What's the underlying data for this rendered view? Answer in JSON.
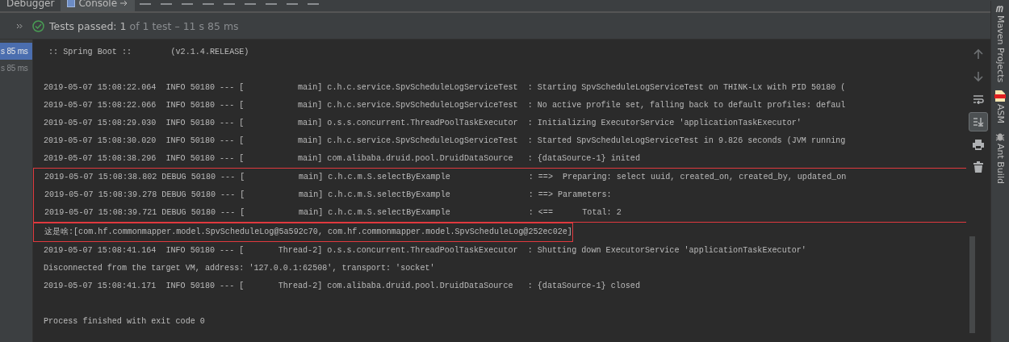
{
  "tool_tabs": [
    {
      "label": "Debugger",
      "selected": false
    },
    {
      "label": "Console",
      "selected": true
    }
  ],
  "test_status": {
    "passed": true,
    "label": "Tests passed:",
    "count": "1",
    "of_text": "of 1 test",
    "duration": "– 11 s 85 ms"
  },
  "sidebar": {
    "items": [
      {
        "label": "s 85 ms",
        "selected": true
      },
      {
        "label": "s 85 ms",
        "selected": false
      }
    ]
  },
  "console": {
    "blocks": [
      {
        "kind": "line",
        "text": " :: Spring Boot ::        (v2.1.4.RELEASE)"
      },
      {
        "kind": "blank"
      },
      {
        "kind": "line",
        "text": "2019-05-07 15:08:22.064  INFO 50180 --- [           main] c.h.c.service.SpvScheduleLogServiceTest  : Starting SpvScheduleLogServiceTest on THINK-Lx with PID 50180 ("
      },
      {
        "kind": "line",
        "text": "2019-05-07 15:08:22.066  INFO 50180 --- [           main] c.h.c.service.SpvScheduleLogServiceTest  : No active profile set, falling back to default profiles: defaul"
      },
      {
        "kind": "line",
        "text": "2019-05-07 15:08:29.030  INFO 50180 --- [           main] o.s.s.concurrent.ThreadPoolTaskExecutor  : Initializing ExecutorService 'applicationTaskExecutor'"
      },
      {
        "kind": "line",
        "text": "2019-05-07 15:08:30.020  INFO 50180 --- [           main] c.h.c.service.SpvScheduleLogServiceTest  : Started SpvScheduleLogServiceTest in 9.826 seconds (JVM running"
      },
      {
        "kind": "line",
        "text": "2019-05-07 15:08:38.296  INFO 50180 --- [           main] com.alibaba.druid.pool.DruidDataSource   : {dataSource-1} inited"
      },
      {
        "kind": "highlight",
        "lines": [
          "2019-05-07 15:08:38.802 DEBUG 50180 --- [           main] c.h.c.m.S.selectByExample                : ==>  Preparing: select uuid, created_on, created_by, updated_on",
          "2019-05-07 15:08:39.278 DEBUG 50180 --- [           main] c.h.c.m.S.selectByExample                : ==> Parameters: ",
          "2019-05-07 15:08:39.721 DEBUG 50180 --- [           main] c.h.c.m.S.selectByExample                : <==      Total: 2"
        ]
      },
      {
        "kind": "highlight_short",
        "lines": [
          "这是啥:[com.hf.commonmapper.model.SpvScheduleLog@5a592c70, com.hf.commonmapper.model.SpvScheduleLog@252ec02e]"
        ]
      },
      {
        "kind": "line",
        "text": "2019-05-07 15:08:41.164  INFO 50180 --- [       Thread-2] o.s.s.concurrent.ThreadPoolTaskExecutor  : Shutting down ExecutorService 'applicationTaskExecutor'"
      },
      {
        "kind": "line",
        "text": "Disconnected from the target VM, address: '127.0.0.1:62508', transport: 'socket'"
      },
      {
        "kind": "line",
        "text": "2019-05-07 15:08:41.171  INFO 50180 --- [       Thread-2] com.alibaba.druid.pool.DruidDataSource   : {dataSource-1} closed"
      },
      {
        "kind": "blank"
      },
      {
        "kind": "line",
        "text": "Process finished with exit code 0"
      }
    ]
  },
  "gutter_tools": [
    {
      "kind": "up",
      "on": false
    },
    {
      "kind": "down",
      "on": false
    },
    {
      "kind": "wrap",
      "on": false
    },
    {
      "kind": "scroll_end",
      "on": true
    },
    {
      "kind": "print",
      "on": false
    },
    {
      "kind": "trash",
      "on": false
    }
  ],
  "side_strip": [
    {
      "kind": "maven",
      "label": "Maven Projects"
    },
    {
      "kind": "asm",
      "label": "ASM"
    },
    {
      "kind": "ant",
      "label": "Ant Build"
    }
  ]
}
